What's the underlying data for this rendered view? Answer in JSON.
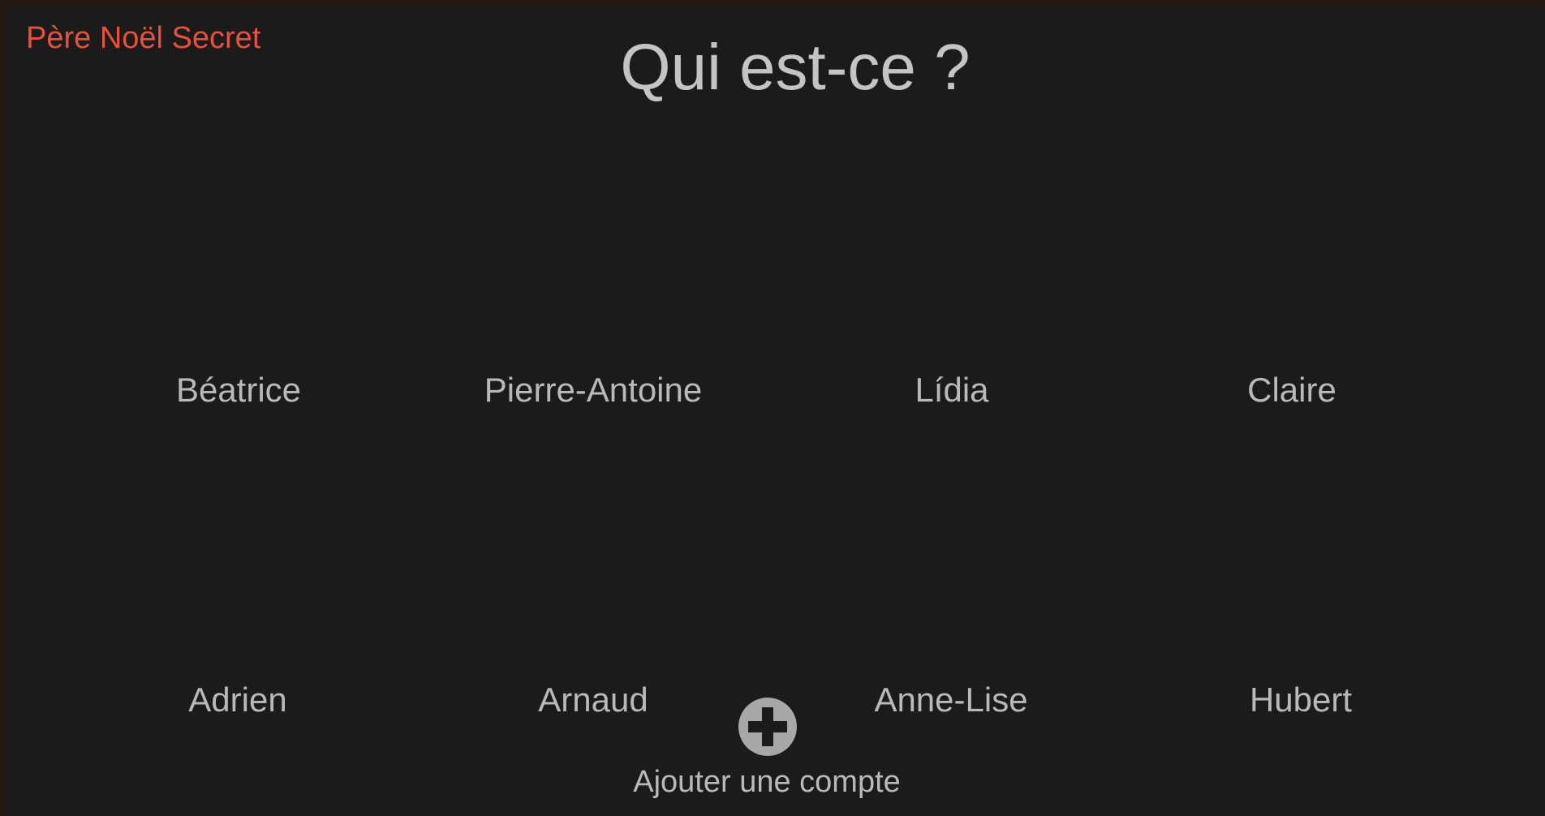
{
  "app": {
    "title": "Père Noël Secret"
  },
  "page": {
    "title": "Qui est-ce ?"
  },
  "profiles": [
    {
      "name": "Béatrice"
    },
    {
      "name": "Pierre-Antoine"
    },
    {
      "name": "Lídia"
    },
    {
      "name": "Claire"
    },
    {
      "name": "Adrien"
    },
    {
      "name": "Arnaud"
    },
    {
      "name": "Anne-Lise"
    },
    {
      "name": "Hubert"
    }
  ],
  "add_account": {
    "label": "Ajouter une compte",
    "icon": "plus-circle-icon"
  },
  "colors": {
    "background": "#1b1b1b",
    "accent": "#e8503a",
    "text": "#b9b9b9",
    "icon": "#a8a8a8"
  }
}
